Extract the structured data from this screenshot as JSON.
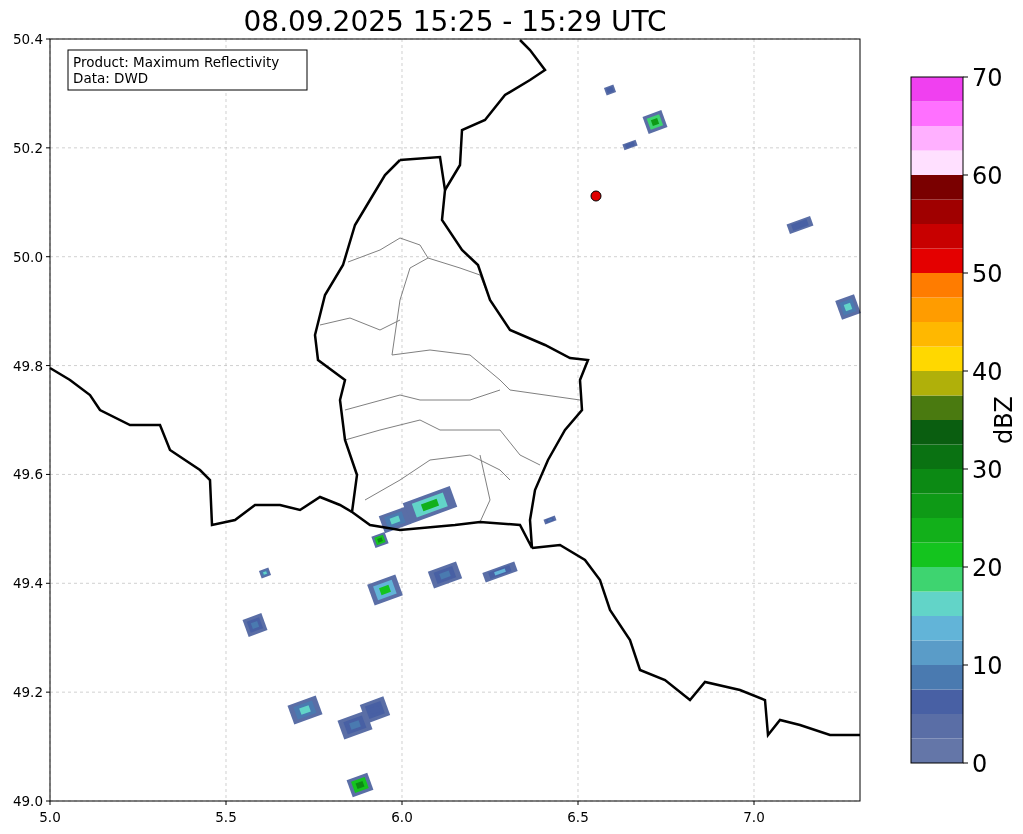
{
  "title": "08.09.2025 15:25 - 15:29 UTC",
  "map": {
    "info_lines": [
      "Product: Maximum Reflectivity",
      "Data: DWD"
    ],
    "xticks": [
      "5.0",
      "5.5",
      "6.0",
      "6.5",
      "7.0"
    ],
    "yticks": [
      "50.4",
      "50.2",
      "50.0",
      "49.8",
      "49.6",
      "49.4",
      "49.2",
      "49.0"
    ]
  },
  "colorbar": {
    "label": "dBZ",
    "ticks": [
      "70",
      "60",
      "50",
      "40",
      "30",
      "20",
      "10",
      "0"
    ],
    "levels": [
      {
        "color": "#6476a8"
      },
      {
        "color": "#5a6ea6"
      },
      {
        "color": "#4860a4"
      },
      {
        "color": "#4a7ab0"
      },
      {
        "color": "#5a9cc8"
      },
      {
        "color": "#62b4d8"
      },
      {
        "color": "#62d4c8"
      },
      {
        "color": "#3ed470"
      },
      {
        "color": "#14c41e"
      },
      {
        "color": "#12b01a"
      },
      {
        "color": "#0e9a16"
      },
      {
        "color": "#0c8a14"
      },
      {
        "color": "#0a7212"
      },
      {
        "color": "#0a5e10"
      },
      {
        "color": "#4a7a10"
      },
      {
        "color": "#b0b00a"
      },
      {
        "color": "#ffd800"
      },
      {
        "color": "#ffb800"
      },
      {
        "color": "#ff9c00"
      },
      {
        "color": "#ff7c00"
      },
      {
        "color": "#e40000"
      },
      {
        "color": "#c80000"
      },
      {
        "color": "#a00000"
      },
      {
        "color": "#7a0000"
      },
      {
        "color": "#ffe0ff"
      },
      {
        "color": "#ffb0ff"
      },
      {
        "color": "#ff70ff"
      },
      {
        "color": "#f040f0"
      }
    ]
  }
}
